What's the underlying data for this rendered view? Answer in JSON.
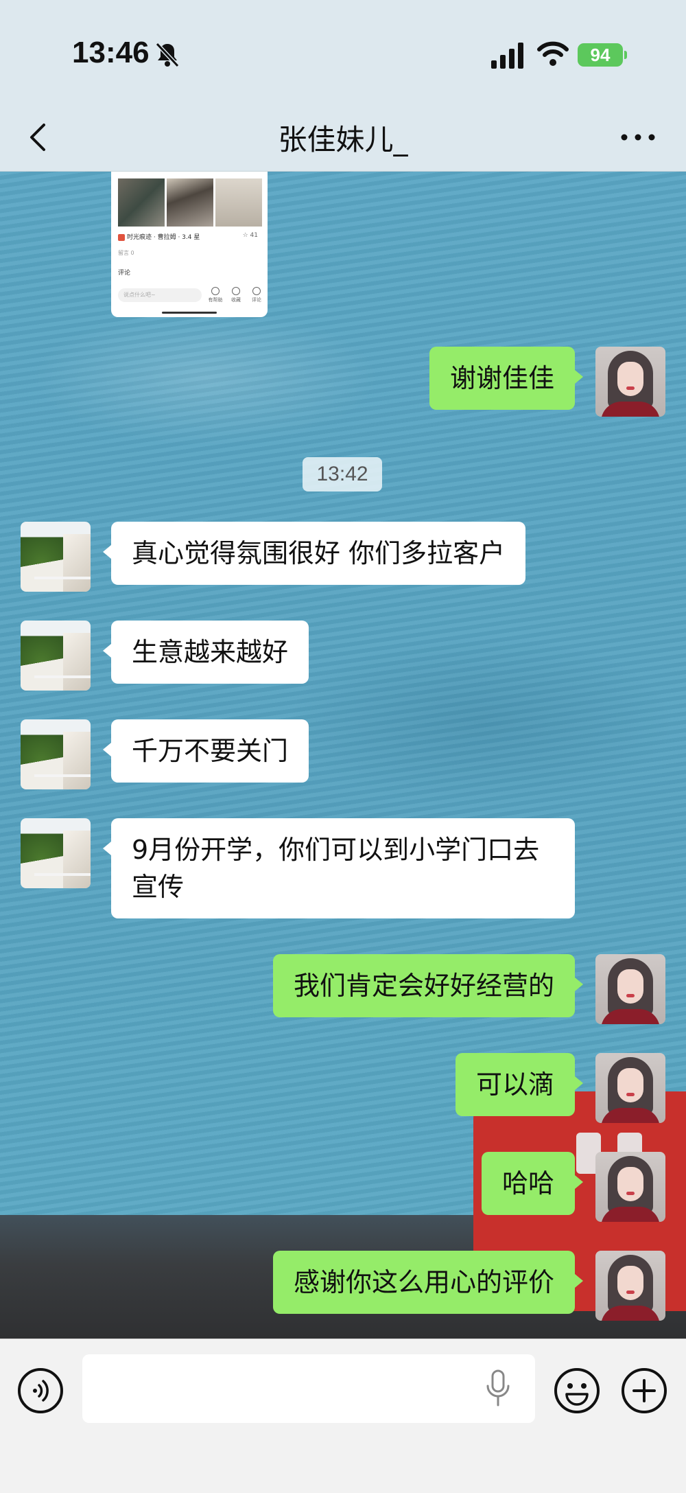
{
  "status_bar": {
    "time": "13:46",
    "battery": "94"
  },
  "nav": {
    "title": "张佳妹儿_"
  },
  "shared_image": {
    "source_text": "时光痕迹 · 曹拉姆 · 3.4 星",
    "likes": "☆ 41",
    "line1": "留言 0",
    "line2": "评论",
    "input_placeholder": "说点什么吧~",
    "icon1": "有帮助",
    "icon2": "收藏",
    "icon3": "评论"
  },
  "timestamp": "13:42",
  "messages": [
    {
      "side": "right",
      "text": "谢谢佳佳"
    },
    {
      "side": "left",
      "text": "真心觉得氛围很好 你们多拉客户"
    },
    {
      "side": "left",
      "text": "生意越来越好"
    },
    {
      "side": "left",
      "text": "千万不要关门"
    },
    {
      "side": "left",
      "text": "9月份开学，你们可以到小学门口去宣传"
    },
    {
      "side": "right",
      "text": "我们肯定会好好经营的"
    },
    {
      "side": "right",
      "text": "可以滴"
    },
    {
      "side": "right",
      "text": "哈哈"
    },
    {
      "side": "right",
      "text": "感谢你这么用心的评价"
    }
  ],
  "input": {
    "value": ""
  },
  "icons": {
    "bell": "bell-slash-icon",
    "signal": "signal-icon",
    "wifi": "wifi-icon",
    "back": "chevron-left-icon",
    "more": "more-icon",
    "voice": "voice-icon",
    "mic": "mic-icon",
    "emoji": "emoji-icon",
    "plus": "plus-icon"
  },
  "colors": {
    "my_bubble": "#95ec69",
    "their_bubble": "#ffffff",
    "battery": "#5cc85c"
  }
}
